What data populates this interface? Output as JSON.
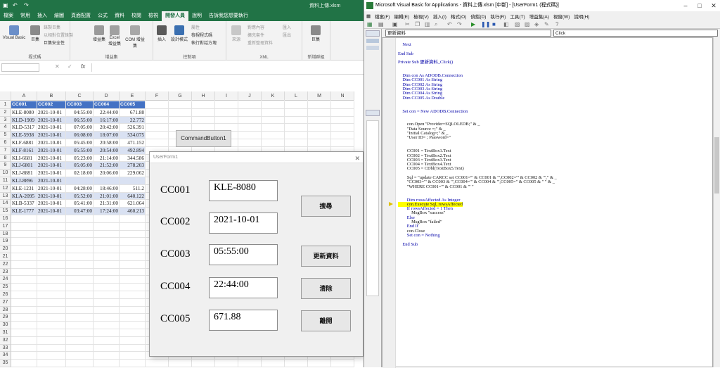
{
  "excel": {
    "title": "資料上傳.xlsm",
    "tabs": [
      "檔案",
      "常用",
      "插入",
      "繪圖",
      "頁面配置",
      "公式",
      "資料",
      "校閱",
      "檢視",
      "開發人員",
      "說明",
      "告訴我您想要執行"
    ],
    "active_tab": "開發人員",
    "ribbon": {
      "groups": [
        {
          "label": "程式碼",
          "items": [
            "Visual Basic",
            "巨集",
            "錄製巨集",
            "以相對位置錄製",
            "巨集安全性"
          ]
        },
        {
          "label": "增益集",
          "items": [
            "增益集",
            "Excel 增益集",
            "COM 增益集"
          ]
        },
        {
          "label": "控制項",
          "items": [
            "插入",
            "設計模式",
            "屬性",
            "檢視程式碼",
            "執行對話方塊"
          ]
        },
        {
          "label": "XML",
          "items": [
            "來源",
            "對應內容",
            "擴充套件",
            "重新整理資料",
            "匯入",
            "匯出"
          ]
        },
        {
          "label": "新增群組",
          "items": [
            "巨集"
          ]
        }
      ]
    },
    "formula_bar": {
      "fx": "fx",
      "cancel": "✕",
      "enter": "✓"
    },
    "columns": [
      "A",
      "B",
      "C",
      "D",
      "E",
      "F",
      "G",
      "H",
      "I",
      "J",
      "K",
      "L",
      "M",
      "N"
    ],
    "headers": [
      "CC001",
      "CC002",
      "CC003",
      "CC004",
      "CC005"
    ],
    "rows": [
      [
        "KLE-8080",
        "2021-10-01",
        "04:55:00",
        "22:44:00",
        "671.88"
      ],
      [
        "KLD-1909",
        "2021-10-01",
        "06:55:00",
        "16:17:00",
        "22.772"
      ],
      [
        "KLD-5317",
        "2021-10-01",
        "07:05:00",
        "20:42:00",
        "526.391"
      ],
      [
        "KLE-5938",
        "2021-10-01",
        "06:08:00",
        "18:07:00",
        "534.075"
      ],
      [
        "KLF-6881",
        "2021-10-01",
        "05:45:00",
        "20:58:00",
        "471.152"
      ],
      [
        "KLF-8161",
        "2021-10-01",
        "05:55:00",
        "20:54:00",
        "492.894"
      ],
      [
        "KLI-6681",
        "2021-10-01",
        "05:23:00",
        "21:14:00",
        "344.586"
      ],
      [
        "KLJ-6801",
        "2021-10-01",
        "05:05:00",
        "21:52:00",
        "278.203"
      ],
      [
        "KLJ-8881",
        "2021-10-01",
        "02:18:00",
        "20:06:00",
        "229.062"
      ],
      [
        "KLJ-8896",
        "2021-10-01",
        "",
        "",
        ""
      ],
      [
        "KLE-1231",
        "2021-10-01",
        "04:28:00",
        "18:46:00",
        "511.2"
      ],
      [
        "KLA-2095",
        "2021-10-01",
        "05:52:00",
        "21:01:00",
        "640.122"
      ],
      [
        "KLB-5337",
        "2021-10-01",
        "05:41:00",
        "21:31:00",
        "621.064"
      ],
      [
        "KLE-1777",
        "2021-10-01",
        "03:47:00",
        "17:24:00",
        "460.213"
      ]
    ],
    "row_numbers": [
      "1",
      "2",
      "3",
      "4",
      "5",
      "6",
      "7",
      "8",
      "9",
      "10",
      "11",
      "12",
      "13",
      "14",
      "15",
      "16",
      "17",
      "18",
      "19",
      "20",
      "21",
      "22",
      "23",
      "24",
      "25",
      "26",
      "27",
      "28",
      "29",
      "30",
      "31",
      "32",
      "33",
      "34",
      "35"
    ],
    "command_button": "CommandButton1"
  },
  "userform": {
    "title": "UserForm1",
    "fields": [
      {
        "label": "CC001",
        "value": "KLE-8080"
      },
      {
        "label": "CC002",
        "value": "2021-10-01"
      },
      {
        "label": "CC003",
        "value": "05:55:00"
      },
      {
        "label": "CC004",
        "value": "22:44:00"
      },
      {
        "label": "CC005",
        "value": "671.88"
      }
    ],
    "buttons": {
      "search": "搜尋",
      "update": "更新資料",
      "clear": "清除",
      "exit": "離開"
    }
  },
  "vba": {
    "title": "Microsoft Visual Basic for Applications - 資料上傳.xlsm [中斷] - [UserForm1 (程式碼)]",
    "menu": [
      "檔案(F)",
      "編輯(E)",
      "檢視(V)",
      "插入(I)",
      "格式(O)",
      "偵錯(D)",
      "執行(R)",
      "工具(T)",
      "增益集(A)",
      "視窗(W)",
      "說明(H)"
    ],
    "object_combo": "更新資料",
    "proc_combo": "Click",
    "code": [
      "    Next",
      "",
      "End Sub",
      "",
      "Private Sub 更新資料_Click()",
      "",
      "",
      "    Dim con As ADODB.Connection",
      "    Dim CC001 As String",
      "    Dim CC002 As String",
      "    Dim CC003 As String",
      "    Dim CC004 As String",
      "    Dim CC005 As Double",
      "",
      "",
      "    Set con = New ADODB.Connection",
      "",
      "",
      "        con.Open \"Provider=SQLOLEDB;\" & _",
      "        \"Data Source =;\" & _",
      "        \"Initial Catalog=;\" & _",
      "        \"User ID= ; Password=\"",
      "",
      "",
      "        CC001 = TextBox1.Text",
      "        CC002 = TextBox2.Text",
      "        CC003 = TextBox3.Text",
      "        CC004 = TextBox4.Text",
      "        CC005 = CDbl(TextBox5.Text)",
      "",
      "        Sql = \"update CARCC set CC001='\" & CC001 & \"',CC002='\" & CC002 & \"',\" & _",
      "        \"CC003='\" & CC003 & \"',CC004='\" & CC004 & \"',CC005=\" & CC005 & \" \" & _",
      "        \"WHERE CC001='\" & CC001 & \"' \"",
      "",
      "",
      "        Dim rowsAffected As Integer",
      "        con.Execute Sql, rowsAffected",
      "        If rowsAffected = 1 Then",
      "            MsgBox \"success\"",
      "        Else",
      "            MsgBox \"failed\"",
      "        End If",
      "        con.Close",
      "        Set con = Nothing",
      "",
      "    End Sub"
    ],
    "highlight_line": 36,
    "highlight_color": "#ffff00"
  }
}
